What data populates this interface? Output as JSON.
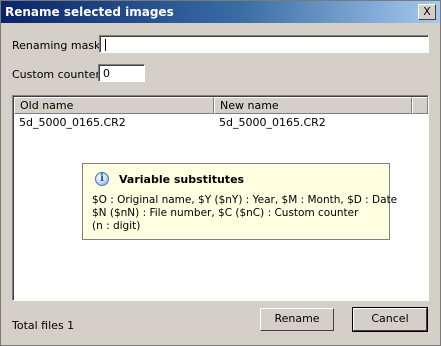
{
  "window": {
    "title": "Rename selected images",
    "close_label": "X"
  },
  "form": {
    "renaming_mask_label": "Renaming mask",
    "renaming_mask_value": "",
    "custom_counter_label": "Custom counter",
    "custom_counter_value": "0"
  },
  "list": {
    "columns": [
      "Old name",
      "New name"
    ],
    "rows": [
      {
        "old_name": "5d_5000_0165.CR2",
        "new_name": "5d_5000_0165.CR2"
      }
    ]
  },
  "tooltip": {
    "icon": "info-icon",
    "title": "Variable substitutes",
    "lines": [
      "$O : Original name, $Y ($nY) : Year, $M : Month, $D : Date",
      "$N ($nN) : File number, $C ($nC) : Custom counter",
      "(n : digit)"
    ]
  },
  "footer": {
    "total_files": "Total files 1",
    "rename_label": "Rename",
    "cancel_label": "Cancel"
  }
}
